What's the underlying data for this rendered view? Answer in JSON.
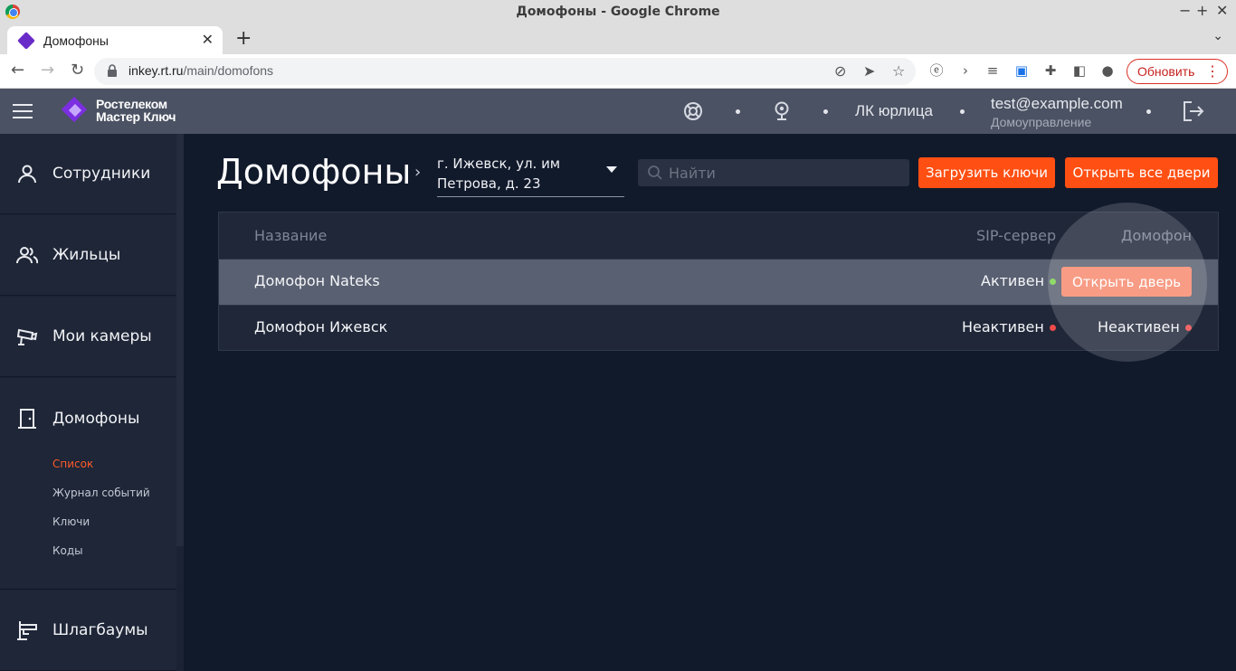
{
  "browser": {
    "window_title": "Домофоны - Google Chrome",
    "tab_title": "Домофоны",
    "url_host": "inkey.rt.ru",
    "url_path": "/main/domofons",
    "update_label": "Обновить"
  },
  "header": {
    "logo_line1": "Ростелеком",
    "logo_line2": "Мастер Ключ",
    "account_type": "ЛК юрлица",
    "email": "test@example.com",
    "org": "Домоуправление"
  },
  "sidebar": {
    "items": [
      {
        "label": "Сотрудники",
        "icon": "person-icon"
      },
      {
        "label": "Жильцы",
        "icon": "people-icon"
      },
      {
        "label": "Мои камеры",
        "icon": "camera-icon"
      },
      {
        "label": "Домофоны",
        "icon": "door-icon"
      },
      {
        "label": "Шлагбаумы",
        "icon": "barrier-icon"
      }
    ],
    "subitems": [
      {
        "label": "Список",
        "active": true
      },
      {
        "label": "Журнал событий",
        "active": false
      },
      {
        "label": "Ключи",
        "active": false
      },
      {
        "label": "Коды",
        "active": false
      }
    ]
  },
  "main": {
    "title": "Домофоны",
    "address_line1": "г. Ижевск, ул. им",
    "address_line2": "Петрова, д. 23",
    "search_placeholder": "Найти",
    "btn_upload_keys": "Загрузить ключи",
    "btn_open_all": "Открыть все двери"
  },
  "table": {
    "columns": {
      "name": "Название",
      "sip": "SIP-сервер",
      "intercom": "Домофон"
    },
    "rows": [
      {
        "name": "Домофон Nateks",
        "sip": "Активен",
        "sip_status_color": "#7bd24f",
        "action": "Открыть дверь"
      },
      {
        "name": "Домофон Ижевск",
        "sip": "Неактивен",
        "sip_status_color": "#ef4a4a",
        "intercom": "Неактивен",
        "intercom_status_color": "#ef4a4a"
      }
    ]
  },
  "colors": {
    "accent": "#ff4f12",
    "active_link": "#ff5a2a"
  }
}
